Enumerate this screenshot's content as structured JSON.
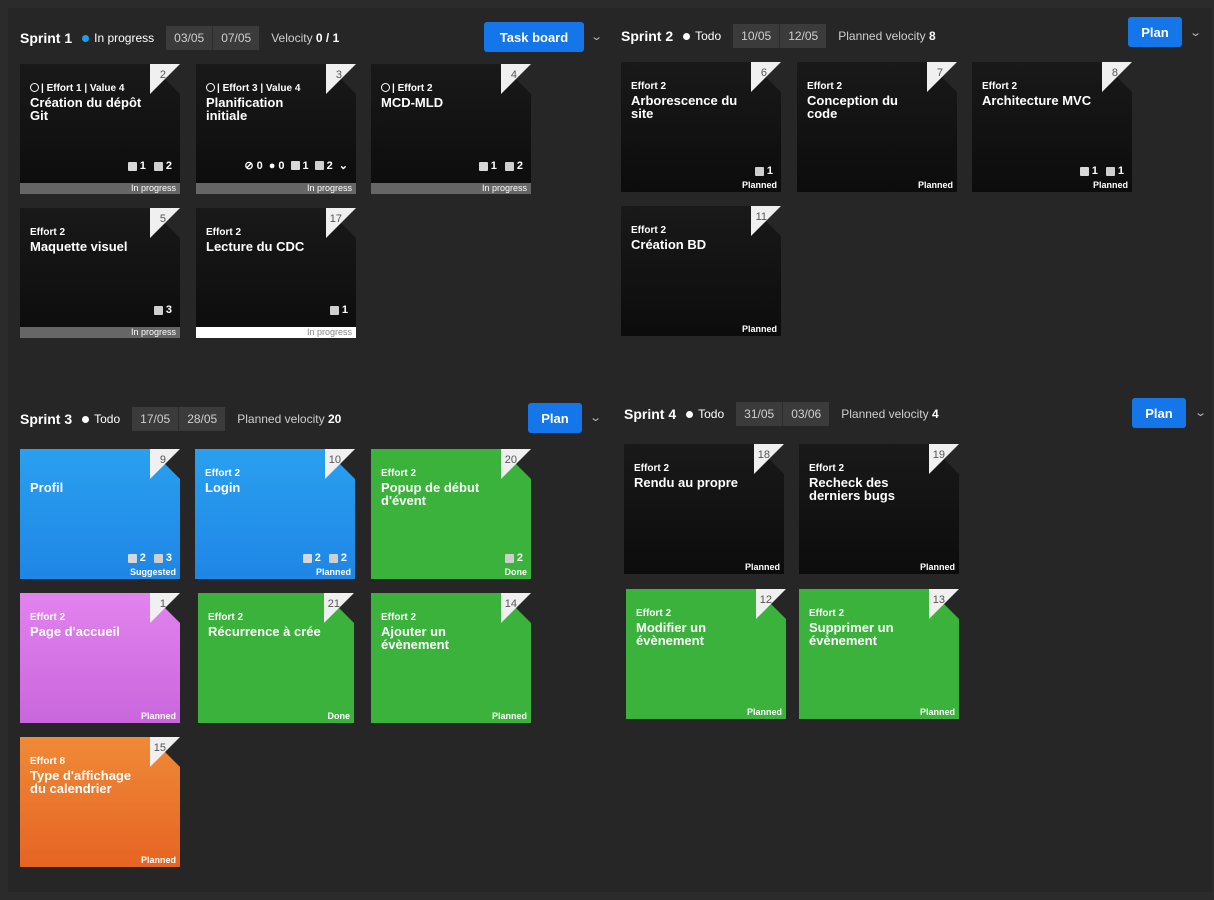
{
  "sprints": [
    {
      "name": "Sprint 1",
      "status": "In progress",
      "status_color": "#1e9ef0",
      "start": "03/05",
      "end": "07/05",
      "velocity_label": "Velocity",
      "velocity_value": "0 / 1",
      "button": "Task board",
      "cards": [
        {
          "num": "2",
          "meta": "| Effort 1 | Value 4",
          "title": "Création du dépôt Git",
          "badges": [
            "1",
            "2"
          ],
          "status": "In progress"
        },
        {
          "num": "3",
          "meta": "| Effort 3 | Value 4",
          "title": "Planification initiale",
          "badges": [
            "0",
            "0",
            "1",
            "2"
          ],
          "status": "In progress"
        },
        {
          "num": "4",
          "meta": "| Effort 2",
          "title": "MCD-MLD",
          "badges": [
            "1",
            "2"
          ],
          "status": "In progress"
        },
        {
          "num": "5",
          "meta": "Effort 2",
          "title": "Maquette visuel",
          "badges": [
            "3"
          ],
          "status": "In progress"
        },
        {
          "num": "17",
          "meta": "Effort 2",
          "title": "Lecture du CDC",
          "badges": [
            "1"
          ],
          "status": "In progress"
        }
      ]
    },
    {
      "name": "Sprint 2",
      "status": "Todo",
      "status_color": "#ffffff",
      "start": "10/05",
      "end": "12/05",
      "velocity_label": "Planned velocity",
      "velocity_value": "8",
      "button": "Plan",
      "cards": [
        {
          "num": "6",
          "meta": "Effort 2",
          "title": "Arborescence du site",
          "badges": [
            "1"
          ],
          "status": "Planned"
        },
        {
          "num": "7",
          "meta": "Effort 2",
          "title": "Conception du code",
          "badges": [],
          "status": "Planned"
        },
        {
          "num": "8",
          "meta": "Effort 2",
          "title": "Architecture MVC",
          "badges": [
            "1",
            "1"
          ],
          "status": "Planned"
        },
        {
          "num": "11",
          "meta": "Effort 2",
          "title": "Création BD",
          "badges": [],
          "status": "Planned"
        }
      ]
    },
    {
      "name": "Sprint 3",
      "status": "Todo",
      "status_color": "#ffffff",
      "start": "17/05",
      "end": "28/05",
      "velocity_label": "Planned velocity",
      "velocity_value": "20",
      "button": "Plan",
      "cards": [
        {
          "num": "9",
          "meta": "",
          "title": "Profil",
          "badges": [
            "2",
            "3"
          ],
          "status": "Suggested"
        },
        {
          "num": "10",
          "meta": "Effort 2",
          "title": "Login",
          "badges": [
            "2",
            "2"
          ],
          "status": "Planned"
        },
        {
          "num": "20",
          "meta": "Effort 2",
          "title": "Popup de début d'évent",
          "badges": [
            "2"
          ],
          "status": "Done"
        },
        {
          "num": "1",
          "meta": "Effort 2",
          "title": "Page d'accueil",
          "badges": [],
          "status": "Planned"
        },
        {
          "num": "21",
          "meta": "Effort 2",
          "title": "Récurrence à crée",
          "badges": [],
          "status": "Done"
        },
        {
          "num": "14",
          "meta": "Effort 2",
          "title": "Ajouter un évènement",
          "badges": [],
          "status": "Planned"
        },
        {
          "num": "15",
          "meta": "Effort 8",
          "title": "Type d'affichage du calendrier",
          "badges": [],
          "status": "Planned"
        }
      ]
    },
    {
      "name": "Sprint 4",
      "status": "Todo",
      "status_color": "#ffffff",
      "start": "31/05",
      "end": "03/06",
      "velocity_label": "Planned velocity",
      "velocity_value": "4",
      "button": "Plan",
      "cards": [
        {
          "num": "18",
          "meta": "Effort 2",
          "title": "Rendu au propre",
          "badges": [],
          "status": "Planned"
        },
        {
          "num": "19",
          "meta": "Effort 2",
          "title": "Recheck des derniers bugs",
          "badges": [],
          "status": "Planned"
        },
        {
          "num": "12",
          "meta": "Effort 2",
          "title": "Modifier un évènement",
          "badges": [],
          "status": "Planned"
        },
        {
          "num": "13",
          "meta": "Effort 2",
          "title": "Supprimer un évènement",
          "badges": [],
          "status": "Planned"
        }
      ]
    }
  ],
  "colors": {
    "accent": "#1476e8",
    "dark_card": "#121212",
    "blue_card": "#2295ec",
    "green_card": "#3bb23b",
    "purple_card": "#d774e6",
    "orange_card": "#ea7630"
  },
  "icons": {
    "menu_chevron": "chevron-down-icon",
    "task": "checkbox-icon",
    "doc": "document-icon",
    "attachment": "paperclip-icon",
    "comment": "comment-icon"
  }
}
